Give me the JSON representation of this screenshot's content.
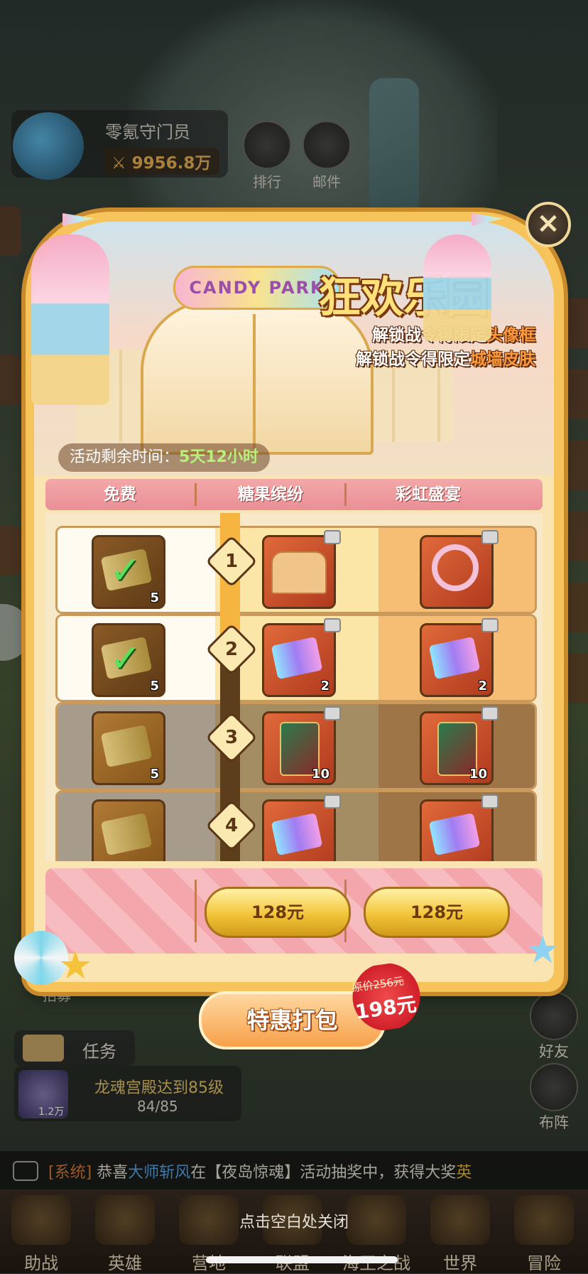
{
  "hud": {
    "player_name": "零氪守门员",
    "power": "9956.8万",
    "rank_label": "排行",
    "mail_label": "邮件",
    "friend_label": "好友",
    "formation_label": "布阵",
    "task_label": "任务",
    "recruit_label": "招募",
    "quest_title": "龙魂宫殿达到85级",
    "quest_progress": "84/85",
    "quest_reward": "1.2万"
  },
  "chat": {
    "tag": "[系统]",
    "pre": " 恭喜",
    "name": "大师斩风",
    "mid": "在【夜岛惊魂】活动抽奖中，获得大奖",
    "tail": "英"
  },
  "bottom_nav": [
    {
      "label": "助战",
      "icon": "assist-icon"
    },
    {
      "label": "英雄",
      "icon": "hero-icon"
    },
    {
      "label": "营地",
      "icon": "camp-icon"
    },
    {
      "label": "联盟",
      "icon": "alliance-icon"
    },
    {
      "label": "海王之战",
      "icon": "sea-king-icon"
    },
    {
      "label": "世界",
      "icon": "world-compass-icon"
    },
    {
      "label": "冒险",
      "icon": "adventure-icon"
    }
  ],
  "close_hint": "点击空白处关闭",
  "modal": {
    "logo_text": "CANDY PARK",
    "title": "狂欢乐园",
    "unlock_lines": [
      {
        "prefix": "解锁战令得限定",
        "highlight": "头像框"
      },
      {
        "prefix": "解锁战令得限定",
        "highlight": "城墙皮肤"
      }
    ],
    "timer_label": "活动剩余时间：",
    "timer_value": "5天12小时",
    "columns": [
      "免费",
      "糖果缤纷",
      "彩虹盛宴"
    ],
    "rows": [
      {
        "level": "1",
        "state": "claimed",
        "free": {
          "icon": "gold-ticket-icon",
          "qty": "5"
        },
        "candy": {
          "icon": "castle-skin-icon",
          "qty": ""
        },
        "rainbow": {
          "icon": "avatar-frame-icon",
          "qty": ""
        }
      },
      {
        "level": "2",
        "state": "claimed",
        "free": {
          "icon": "gold-ticket-icon",
          "qty": "5"
        },
        "candy": {
          "icon": "rainbow-ticket-icon",
          "qty": "2"
        },
        "rainbow": {
          "icon": "rainbow-ticket-icon",
          "qty": "2"
        }
      },
      {
        "level": "3",
        "state": "locked",
        "free": {
          "icon": "gold-ticket-icon",
          "qty": "5"
        },
        "candy": {
          "icon": "hero-card-icon",
          "qty": "10"
        },
        "rainbow": {
          "icon": "hero-card-icon",
          "qty": "10"
        }
      },
      {
        "level": "4",
        "state": "locked",
        "free": {
          "icon": "gold-ticket-icon",
          "qty": ""
        },
        "candy": {
          "icon": "rainbow-ticket-icon",
          "qty": ""
        },
        "rainbow": {
          "icon": "rainbow-ticket-icon",
          "qty": ""
        }
      }
    ],
    "candy_price": "128元",
    "rainbow_price": "128元",
    "deal_label": "特惠打包",
    "deal_original": "原价256元",
    "deal_price": "198元",
    "close_icon": "close-icon"
  },
  "colors": {
    "accent_gold": "#f6c45a",
    "header_pink": "#e98f95",
    "highlight_orange": "#ff9a3a",
    "timer_green": "#b8f07a"
  }
}
